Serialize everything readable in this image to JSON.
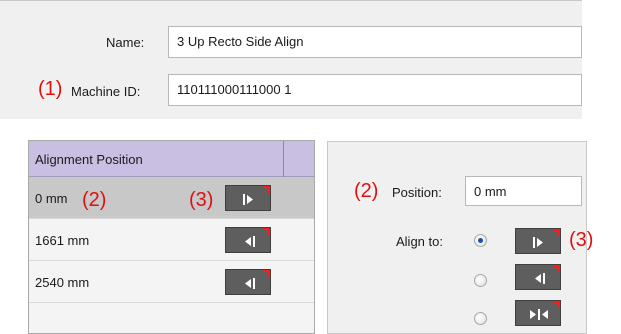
{
  "form": {
    "name_label": "Name:",
    "name_value": "3 Up Recto Side Align",
    "machine_id_label": "Machine ID:",
    "machine_id_value": "110111000111000 1"
  },
  "callouts": {
    "one": "(1)",
    "two": "(2)",
    "three": "(3)"
  },
  "alignment_list": {
    "header": "Alignment Position",
    "rows": [
      {
        "label": "0 mm",
        "icon": "align-right-icon",
        "selected": true
      },
      {
        "label": "1661 mm",
        "icon": "align-left-icon",
        "selected": false
      },
      {
        "label": "2540 mm",
        "icon": "align-left-icon",
        "selected": false
      }
    ]
  },
  "details": {
    "position_label": "Position:",
    "position_value": "0 mm",
    "align_to_label": "Align to:",
    "options": [
      {
        "icon": "align-right-icon",
        "selected": true
      },
      {
        "icon": "align-left-icon",
        "selected": false
      },
      {
        "icon": "align-center-icon",
        "selected": false
      }
    ]
  },
  "colors": {
    "callout": "#e01010",
    "list_header": "#c9bfe2",
    "selected_row": "#c8c8c8",
    "icon_button": "#5e5e5e"
  }
}
